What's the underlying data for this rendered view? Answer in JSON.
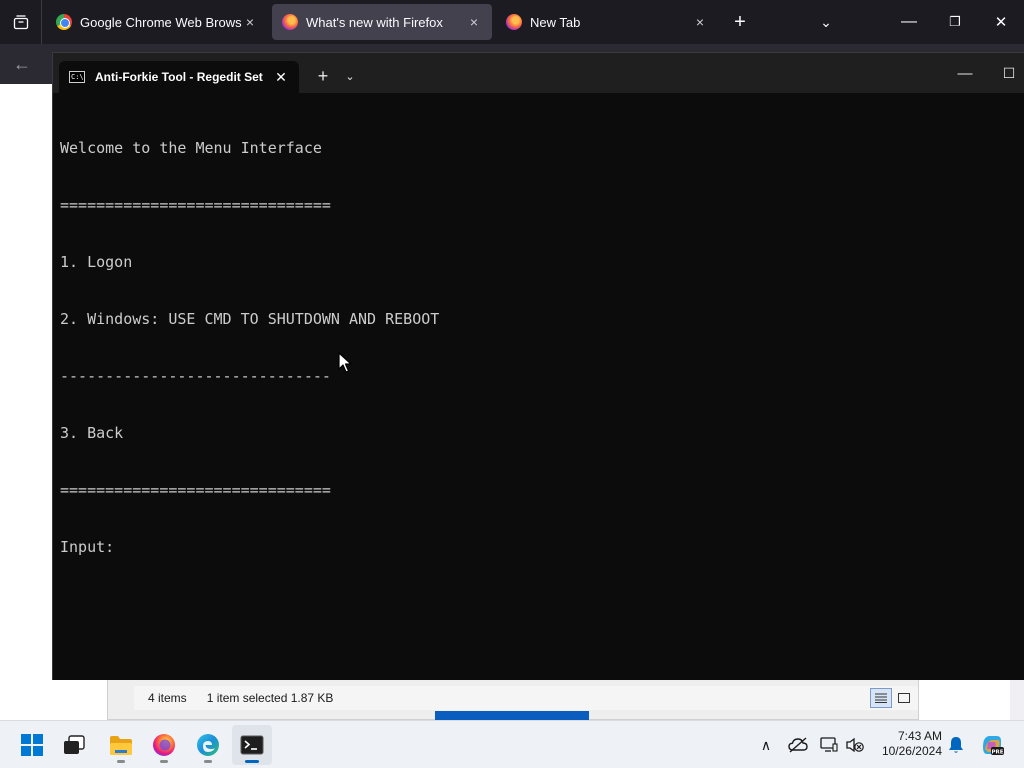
{
  "firefox": {
    "tabs": [
      {
        "label": "Google Chrome Web Browser",
        "icon": "chrome-icon"
      },
      {
        "label": "What's new with Firefox",
        "icon": "firefox-icon",
        "active": true
      },
      {
        "label": "New Tab",
        "icon": "firefox-icon"
      }
    ],
    "close_glyph": "×",
    "new_tab_glyph": "+",
    "list_all_glyph": "⌄",
    "minimize_glyph": "—",
    "restore_glyph": "❐",
    "window_close_glyph": "✕",
    "back_glyph": "←"
  },
  "terminal": {
    "tab_title": "Anti-Forkie Tool - Regedit Set",
    "tab_icon_text": "C:\\",
    "close_glyph": "✕",
    "new_tab_glyph": "+",
    "dropdown_glyph": "⌄",
    "minimize_glyph": "—",
    "maximize_glyph": "☐",
    "lines": [
      "Welcome to the Menu Interface",
      "==============================",
      "1. Logon",
      "2. Windows: USE CMD TO SHUTDOWN AND REBOOT",
      "------------------------------",
      "3. Back",
      "==============================",
      "Input:"
    ],
    "text_color": "#cccccc",
    "background": "#0c0c0c"
  },
  "explorer": {
    "item_count": "4 items",
    "selection": "1 item selected  1.87 KB"
  },
  "taskbar": {
    "apps": [
      "start-icon",
      "task-view-icon",
      "file-explorer-icon",
      "firefox-icon",
      "edge-icon",
      "terminal-icon"
    ],
    "clock_time": "7:43 AM",
    "clock_date": "10/26/2024",
    "tray_chevron": "∧",
    "accent": "#0067c0"
  }
}
